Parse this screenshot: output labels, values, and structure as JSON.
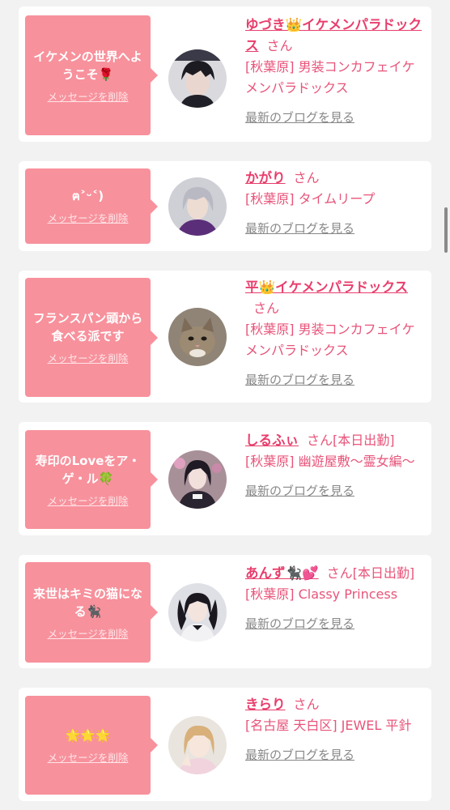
{
  "delete_label": "メッセージを削除",
  "blog_label": "最新のブログを見る",
  "san": "さん",
  "colors": {
    "bubble": "#f7919c",
    "name": "#e83e6c",
    "text": "#e8547a",
    "link": "#888888"
  },
  "cards": [
    {
      "message": "イケメンの世界へようこそ🌹",
      "name": "ゆづき👑イケメンパラドックス",
      "status": "",
      "shop": "[秋葉原] 男装コンカフェイケメンパラドックス",
      "avatar": "dark-hair-man-avatar"
    },
    {
      "message": "ฅ˃ᵕ˂)",
      "name": "かがり",
      "status": "",
      "shop": "[秋葉原] タイムリープ",
      "avatar": "silver-hair-avatar"
    },
    {
      "message": "フランスパン頭から食べる派です",
      "name": "平👑イケメンパラドックス",
      "status": "",
      "shop": "[秋葉原] 男装コンカフェイケメンパラドックス",
      "avatar": "cat-avatar"
    },
    {
      "message": "寿印のLoveをア・ゲ・ル🍀",
      "name": "しるふぃ",
      "status": "[本日出勤]",
      "shop": "[秋葉原] 幽遊屋敷〜霊女編〜",
      "avatar": "gothic-girl-avatar"
    },
    {
      "message": "来世はキミの猫になる🐈‍⬛",
      "name": "あんず🐈‍⬛💕",
      "status": "[本日出勤]",
      "shop": "[秋葉原] Classy Princess",
      "avatar": "twin-tail-girl-avatar"
    },
    {
      "message": "🌟🌟🌟",
      "name": "きらり",
      "status": "",
      "shop": "[名古屋 天白区] JEWEL 平針",
      "avatar": "blonde-girl-avatar"
    }
  ]
}
